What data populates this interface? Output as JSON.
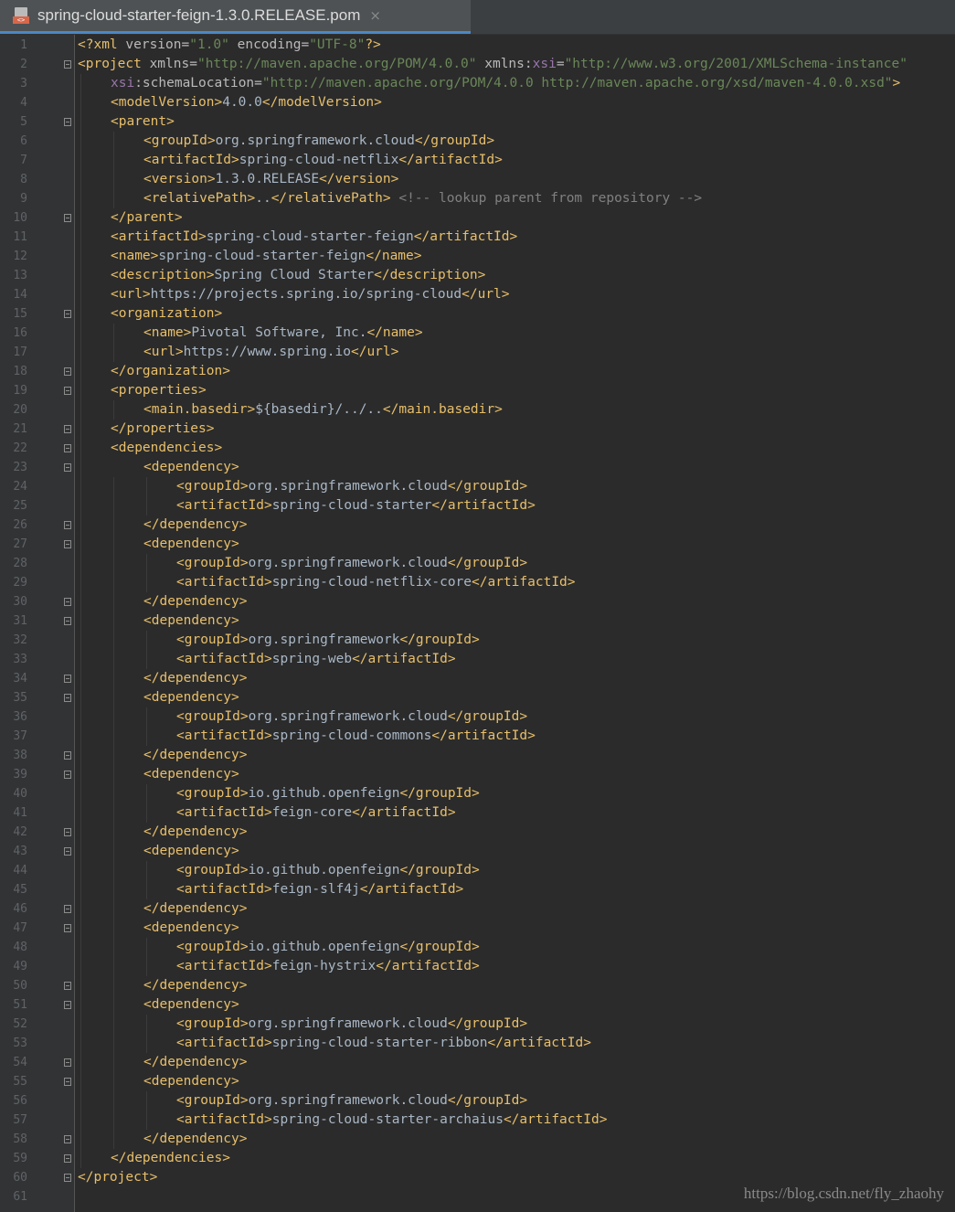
{
  "tab": {
    "filename": "spring-cloud-starter-feign-1.3.0.RELEASE.pom",
    "icon": "pom-file-icon",
    "close": "×"
  },
  "watermark": "https://blog.csdn.net/fly_zhaohy",
  "colors": {
    "tag": "#e8bf6a",
    "text": "#a9b7c6",
    "string": "#6a8759",
    "namespace": "#9876aa",
    "comment": "#808080",
    "background": "#2b2b2b"
  },
  "lines": [
    {
      "n": "1",
      "i": 0,
      "f": false,
      "t": [
        [
          "tag",
          "<?xml "
        ],
        [
          "attr",
          "version="
        ],
        [
          "val",
          "\"1.0\""
        ],
        [
          "attr",
          " encoding="
        ],
        [
          "val",
          "\"UTF-8\""
        ],
        [
          "tag",
          "?>"
        ]
      ]
    },
    {
      "n": "2",
      "i": 0,
      "f": true,
      "t": [
        [
          "tag",
          "<project "
        ],
        [
          "attr",
          "xmlns="
        ],
        [
          "val",
          "\"http://maven.apache.org/POM/4.0.0\""
        ],
        [
          "attr",
          " xmlns:"
        ],
        [
          "ns",
          "xsi"
        ],
        [
          "attr",
          "="
        ],
        [
          "val",
          "\"http://www.w3.org/2001/XMLSchema-instance\""
        ]
      ]
    },
    {
      "n": "3",
      "i": 1,
      "f": false,
      "t": [
        [
          "ns",
          "xsi"
        ],
        [
          "attr",
          ":schemaLocation="
        ],
        [
          "val",
          "\"http://maven.apache.org/POM/4.0.0 http://maven.apache.org/xsd/maven-4.0.0.xsd\""
        ],
        [
          "tag",
          ">"
        ]
      ]
    },
    {
      "n": "4",
      "i": 1,
      "f": false,
      "t": [
        [
          "tag",
          "<modelVersion>"
        ],
        [
          "txt",
          "4.0.0"
        ],
        [
          "tag",
          "</modelVersion>"
        ]
      ]
    },
    {
      "n": "5",
      "i": 1,
      "f": true,
      "t": [
        [
          "tag",
          "<parent>"
        ]
      ]
    },
    {
      "n": "6",
      "i": 2,
      "f": false,
      "t": [
        [
          "tag",
          "<groupId>"
        ],
        [
          "txt",
          "org.springframework.cloud"
        ],
        [
          "tag",
          "</groupId>"
        ]
      ]
    },
    {
      "n": "7",
      "i": 2,
      "f": false,
      "t": [
        [
          "tag",
          "<artifactId>"
        ],
        [
          "txt",
          "spring-cloud-netflix"
        ],
        [
          "tag",
          "</artifactId>"
        ]
      ]
    },
    {
      "n": "8",
      "i": 2,
      "f": false,
      "t": [
        [
          "tag",
          "<version>"
        ],
        [
          "txt",
          "1.3.0.RELEASE"
        ],
        [
          "tag",
          "</version>"
        ]
      ]
    },
    {
      "n": "9",
      "i": 2,
      "f": false,
      "t": [
        [
          "tag",
          "<relativePath>"
        ],
        [
          "txt",
          ".."
        ],
        [
          "tag",
          "</relativePath>"
        ],
        [
          "cmt",
          " <!-- lookup parent from repository -->"
        ]
      ]
    },
    {
      "n": "10",
      "i": 1,
      "f": true,
      "t": [
        [
          "tag",
          "</parent>"
        ]
      ]
    },
    {
      "n": "11",
      "i": 1,
      "f": false,
      "t": [
        [
          "tag",
          "<artifactId>"
        ],
        [
          "txt",
          "spring-cloud-starter-feign"
        ],
        [
          "tag",
          "</artifactId>"
        ]
      ]
    },
    {
      "n": "12",
      "i": 1,
      "f": false,
      "t": [
        [
          "tag",
          "<name>"
        ],
        [
          "txt",
          "spring-cloud-starter-feign"
        ],
        [
          "tag",
          "</name>"
        ]
      ]
    },
    {
      "n": "13",
      "i": 1,
      "f": false,
      "t": [
        [
          "tag",
          "<description>"
        ],
        [
          "txt",
          "Spring Cloud Starter"
        ],
        [
          "tag",
          "</description>"
        ]
      ]
    },
    {
      "n": "14",
      "i": 1,
      "f": false,
      "t": [
        [
          "tag",
          "<url>"
        ],
        [
          "txt",
          "https://projects.spring.io/spring-cloud"
        ],
        [
          "tag",
          "</url>"
        ]
      ]
    },
    {
      "n": "15",
      "i": 1,
      "f": true,
      "t": [
        [
          "tag",
          "<organization>"
        ]
      ]
    },
    {
      "n": "16",
      "i": 2,
      "f": false,
      "t": [
        [
          "tag",
          "<name>"
        ],
        [
          "txt",
          "Pivotal Software, Inc."
        ],
        [
          "tag",
          "</name>"
        ]
      ]
    },
    {
      "n": "17",
      "i": 2,
      "f": false,
      "t": [
        [
          "tag",
          "<url>"
        ],
        [
          "txt",
          "https://www.spring.io"
        ],
        [
          "tag",
          "</url>"
        ]
      ]
    },
    {
      "n": "18",
      "i": 1,
      "f": true,
      "t": [
        [
          "tag",
          "</organization>"
        ]
      ]
    },
    {
      "n": "19",
      "i": 1,
      "f": true,
      "t": [
        [
          "tag",
          "<properties>"
        ]
      ]
    },
    {
      "n": "20",
      "i": 2,
      "f": false,
      "t": [
        [
          "tag",
          "<main.basedir>"
        ],
        [
          "txt",
          "${basedir}/../.."
        ],
        [
          "tag",
          "</main.basedir>"
        ]
      ]
    },
    {
      "n": "21",
      "i": 1,
      "f": true,
      "t": [
        [
          "tag",
          "</properties>"
        ]
      ]
    },
    {
      "n": "22",
      "i": 1,
      "f": true,
      "t": [
        [
          "tag",
          "<dependencies>"
        ]
      ]
    },
    {
      "n": "23",
      "i": 2,
      "f": true,
      "t": [
        [
          "tag",
          "<dependency>"
        ]
      ]
    },
    {
      "n": "24",
      "i": 3,
      "f": false,
      "t": [
        [
          "tag",
          "<groupId>"
        ],
        [
          "txt",
          "org.springframework.cloud"
        ],
        [
          "tag",
          "</groupId>"
        ]
      ]
    },
    {
      "n": "25",
      "i": 3,
      "f": false,
      "t": [
        [
          "tag",
          "<artifactId>"
        ],
        [
          "txt",
          "spring-cloud-starter"
        ],
        [
          "tag",
          "</artifactId>"
        ]
      ]
    },
    {
      "n": "26",
      "i": 2,
      "f": true,
      "t": [
        [
          "tag",
          "</dependency>"
        ]
      ]
    },
    {
      "n": "27",
      "i": 2,
      "f": true,
      "t": [
        [
          "tag",
          "<dependency>"
        ]
      ]
    },
    {
      "n": "28",
      "i": 3,
      "f": false,
      "t": [
        [
          "tag",
          "<groupId>"
        ],
        [
          "txt",
          "org.springframework.cloud"
        ],
        [
          "tag",
          "</groupId>"
        ]
      ]
    },
    {
      "n": "29",
      "i": 3,
      "f": false,
      "t": [
        [
          "tag",
          "<artifactId>"
        ],
        [
          "txt",
          "spring-cloud-netflix-core"
        ],
        [
          "tag",
          "</artifactId>"
        ]
      ]
    },
    {
      "n": "30",
      "i": 2,
      "f": true,
      "t": [
        [
          "tag",
          "</dependency>"
        ]
      ]
    },
    {
      "n": "31",
      "i": 2,
      "f": true,
      "t": [
        [
          "tag",
          "<dependency>"
        ]
      ]
    },
    {
      "n": "32",
      "i": 3,
      "f": false,
      "t": [
        [
          "tag",
          "<groupId>"
        ],
        [
          "txt",
          "org.springframework"
        ],
        [
          "tag",
          "</groupId>"
        ]
      ]
    },
    {
      "n": "33",
      "i": 3,
      "f": false,
      "t": [
        [
          "tag",
          "<artifactId>"
        ],
        [
          "txt",
          "spring-web"
        ],
        [
          "tag",
          "</artifactId>"
        ]
      ]
    },
    {
      "n": "34",
      "i": 2,
      "f": true,
      "t": [
        [
          "tag",
          "</dependency>"
        ]
      ]
    },
    {
      "n": "35",
      "i": 2,
      "f": true,
      "t": [
        [
          "tag",
          "<dependency>"
        ]
      ]
    },
    {
      "n": "36",
      "i": 3,
      "f": false,
      "t": [
        [
          "tag",
          "<groupId>"
        ],
        [
          "txt",
          "org.springframework.cloud"
        ],
        [
          "tag",
          "</groupId>"
        ]
      ]
    },
    {
      "n": "37",
      "i": 3,
      "f": false,
      "t": [
        [
          "tag",
          "<artifactId>"
        ],
        [
          "txt",
          "spring-cloud-commons"
        ],
        [
          "tag",
          "</artifactId>"
        ]
      ]
    },
    {
      "n": "38",
      "i": 2,
      "f": true,
      "t": [
        [
          "tag",
          "</dependency>"
        ]
      ]
    },
    {
      "n": "39",
      "i": 2,
      "f": true,
      "t": [
        [
          "tag",
          "<dependency>"
        ]
      ]
    },
    {
      "n": "40",
      "i": 3,
      "f": false,
      "t": [
        [
          "tag",
          "<groupId>"
        ],
        [
          "txt",
          "io.github.openfeign"
        ],
        [
          "tag",
          "</groupId>"
        ]
      ]
    },
    {
      "n": "41",
      "i": 3,
      "f": false,
      "t": [
        [
          "tag",
          "<artifactId>"
        ],
        [
          "txt",
          "feign-core"
        ],
        [
          "tag",
          "</artifactId>"
        ]
      ]
    },
    {
      "n": "42",
      "i": 2,
      "f": true,
      "t": [
        [
          "tag",
          "</dependency>"
        ]
      ]
    },
    {
      "n": "43",
      "i": 2,
      "f": true,
      "t": [
        [
          "tag",
          "<dependency>"
        ]
      ]
    },
    {
      "n": "44",
      "i": 3,
      "f": false,
      "t": [
        [
          "tag",
          "<groupId>"
        ],
        [
          "txt",
          "io.github.openfeign"
        ],
        [
          "tag",
          "</groupId>"
        ]
      ]
    },
    {
      "n": "45",
      "i": 3,
      "f": false,
      "t": [
        [
          "tag",
          "<artifactId>"
        ],
        [
          "txt",
          "feign-slf4j"
        ],
        [
          "tag",
          "</artifactId>"
        ]
      ]
    },
    {
      "n": "46",
      "i": 2,
      "f": true,
      "t": [
        [
          "tag",
          "</dependency>"
        ]
      ]
    },
    {
      "n": "47",
      "i": 2,
      "f": true,
      "t": [
        [
          "tag",
          "<dependency>"
        ]
      ]
    },
    {
      "n": "48",
      "i": 3,
      "f": false,
      "t": [
        [
          "tag",
          "<groupId>"
        ],
        [
          "txt",
          "io.github.openfeign"
        ],
        [
          "tag",
          "</groupId>"
        ]
      ]
    },
    {
      "n": "49",
      "i": 3,
      "f": false,
      "t": [
        [
          "tag",
          "<artifactId>"
        ],
        [
          "txt",
          "feign-hystrix"
        ],
        [
          "tag",
          "</artifactId>"
        ]
      ]
    },
    {
      "n": "50",
      "i": 2,
      "f": true,
      "t": [
        [
          "tag",
          "</dependency>"
        ]
      ]
    },
    {
      "n": "51",
      "i": 2,
      "f": true,
      "t": [
        [
          "tag",
          "<dependency>"
        ]
      ]
    },
    {
      "n": "52",
      "i": 3,
      "f": false,
      "t": [
        [
          "tag",
          "<groupId>"
        ],
        [
          "txt",
          "org.springframework.cloud"
        ],
        [
          "tag",
          "</groupId>"
        ]
      ]
    },
    {
      "n": "53",
      "i": 3,
      "f": false,
      "t": [
        [
          "tag",
          "<artifactId>"
        ],
        [
          "txt",
          "spring-cloud-starter-ribbon"
        ],
        [
          "tag",
          "</artifactId>"
        ]
      ]
    },
    {
      "n": "54",
      "i": 2,
      "f": true,
      "t": [
        [
          "tag",
          "</dependency>"
        ]
      ]
    },
    {
      "n": "55",
      "i": 2,
      "f": true,
      "t": [
        [
          "tag",
          "<dependency>"
        ]
      ]
    },
    {
      "n": "56",
      "i": 3,
      "f": false,
      "t": [
        [
          "tag",
          "<groupId>"
        ],
        [
          "txt",
          "org.springframework.cloud"
        ],
        [
          "tag",
          "</groupId>"
        ]
      ]
    },
    {
      "n": "57",
      "i": 3,
      "f": false,
      "t": [
        [
          "tag",
          "<artifactId>"
        ],
        [
          "txt",
          "spring-cloud-starter-archaius"
        ],
        [
          "tag",
          "</artifactId>"
        ]
      ]
    },
    {
      "n": "58",
      "i": 2,
      "f": true,
      "t": [
        [
          "tag",
          "</dependency>"
        ]
      ]
    },
    {
      "n": "59",
      "i": 1,
      "f": true,
      "t": [
        [
          "tag",
          "</dependencies>"
        ]
      ]
    },
    {
      "n": "60",
      "i": 0,
      "f": true,
      "t": [
        [
          "tag",
          "</project>"
        ]
      ]
    },
    {
      "n": "61",
      "i": 0,
      "f": false,
      "t": []
    }
  ]
}
